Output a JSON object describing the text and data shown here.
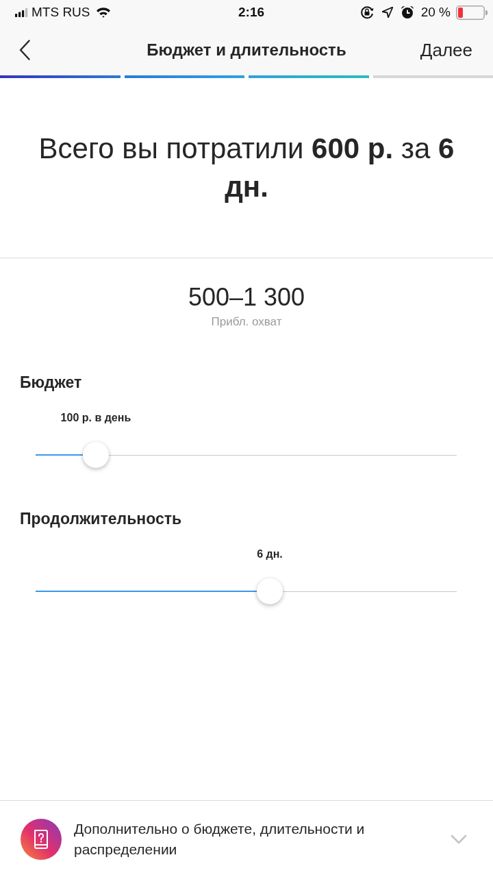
{
  "status_bar": {
    "carrier": "MTS RUS",
    "time": "2:16",
    "battery_percent": "20 %"
  },
  "nav": {
    "title": "Бюджет и длительность",
    "next": "Далее"
  },
  "progress": [
    {
      "done": true
    },
    {
      "done": true
    },
    {
      "done": true
    },
    {
      "done": false
    }
  ],
  "summary": "Всего вы потратили **600 р.** за **6 дн.**",
  "reach": {
    "value": "500–1 300",
    "label": "Прибл. охват"
  },
  "sliders": [
    {
      "title": "Бюджет",
      "value_label": "100 р. в день",
      "level": 0.143
    },
    {
      "title": "Продолжительность",
      "value_label": "6 дн.",
      "level": 0.556
    }
  ],
  "footer": {
    "text": "Дополнительно о бюджете, длительности и распределении"
  }
}
